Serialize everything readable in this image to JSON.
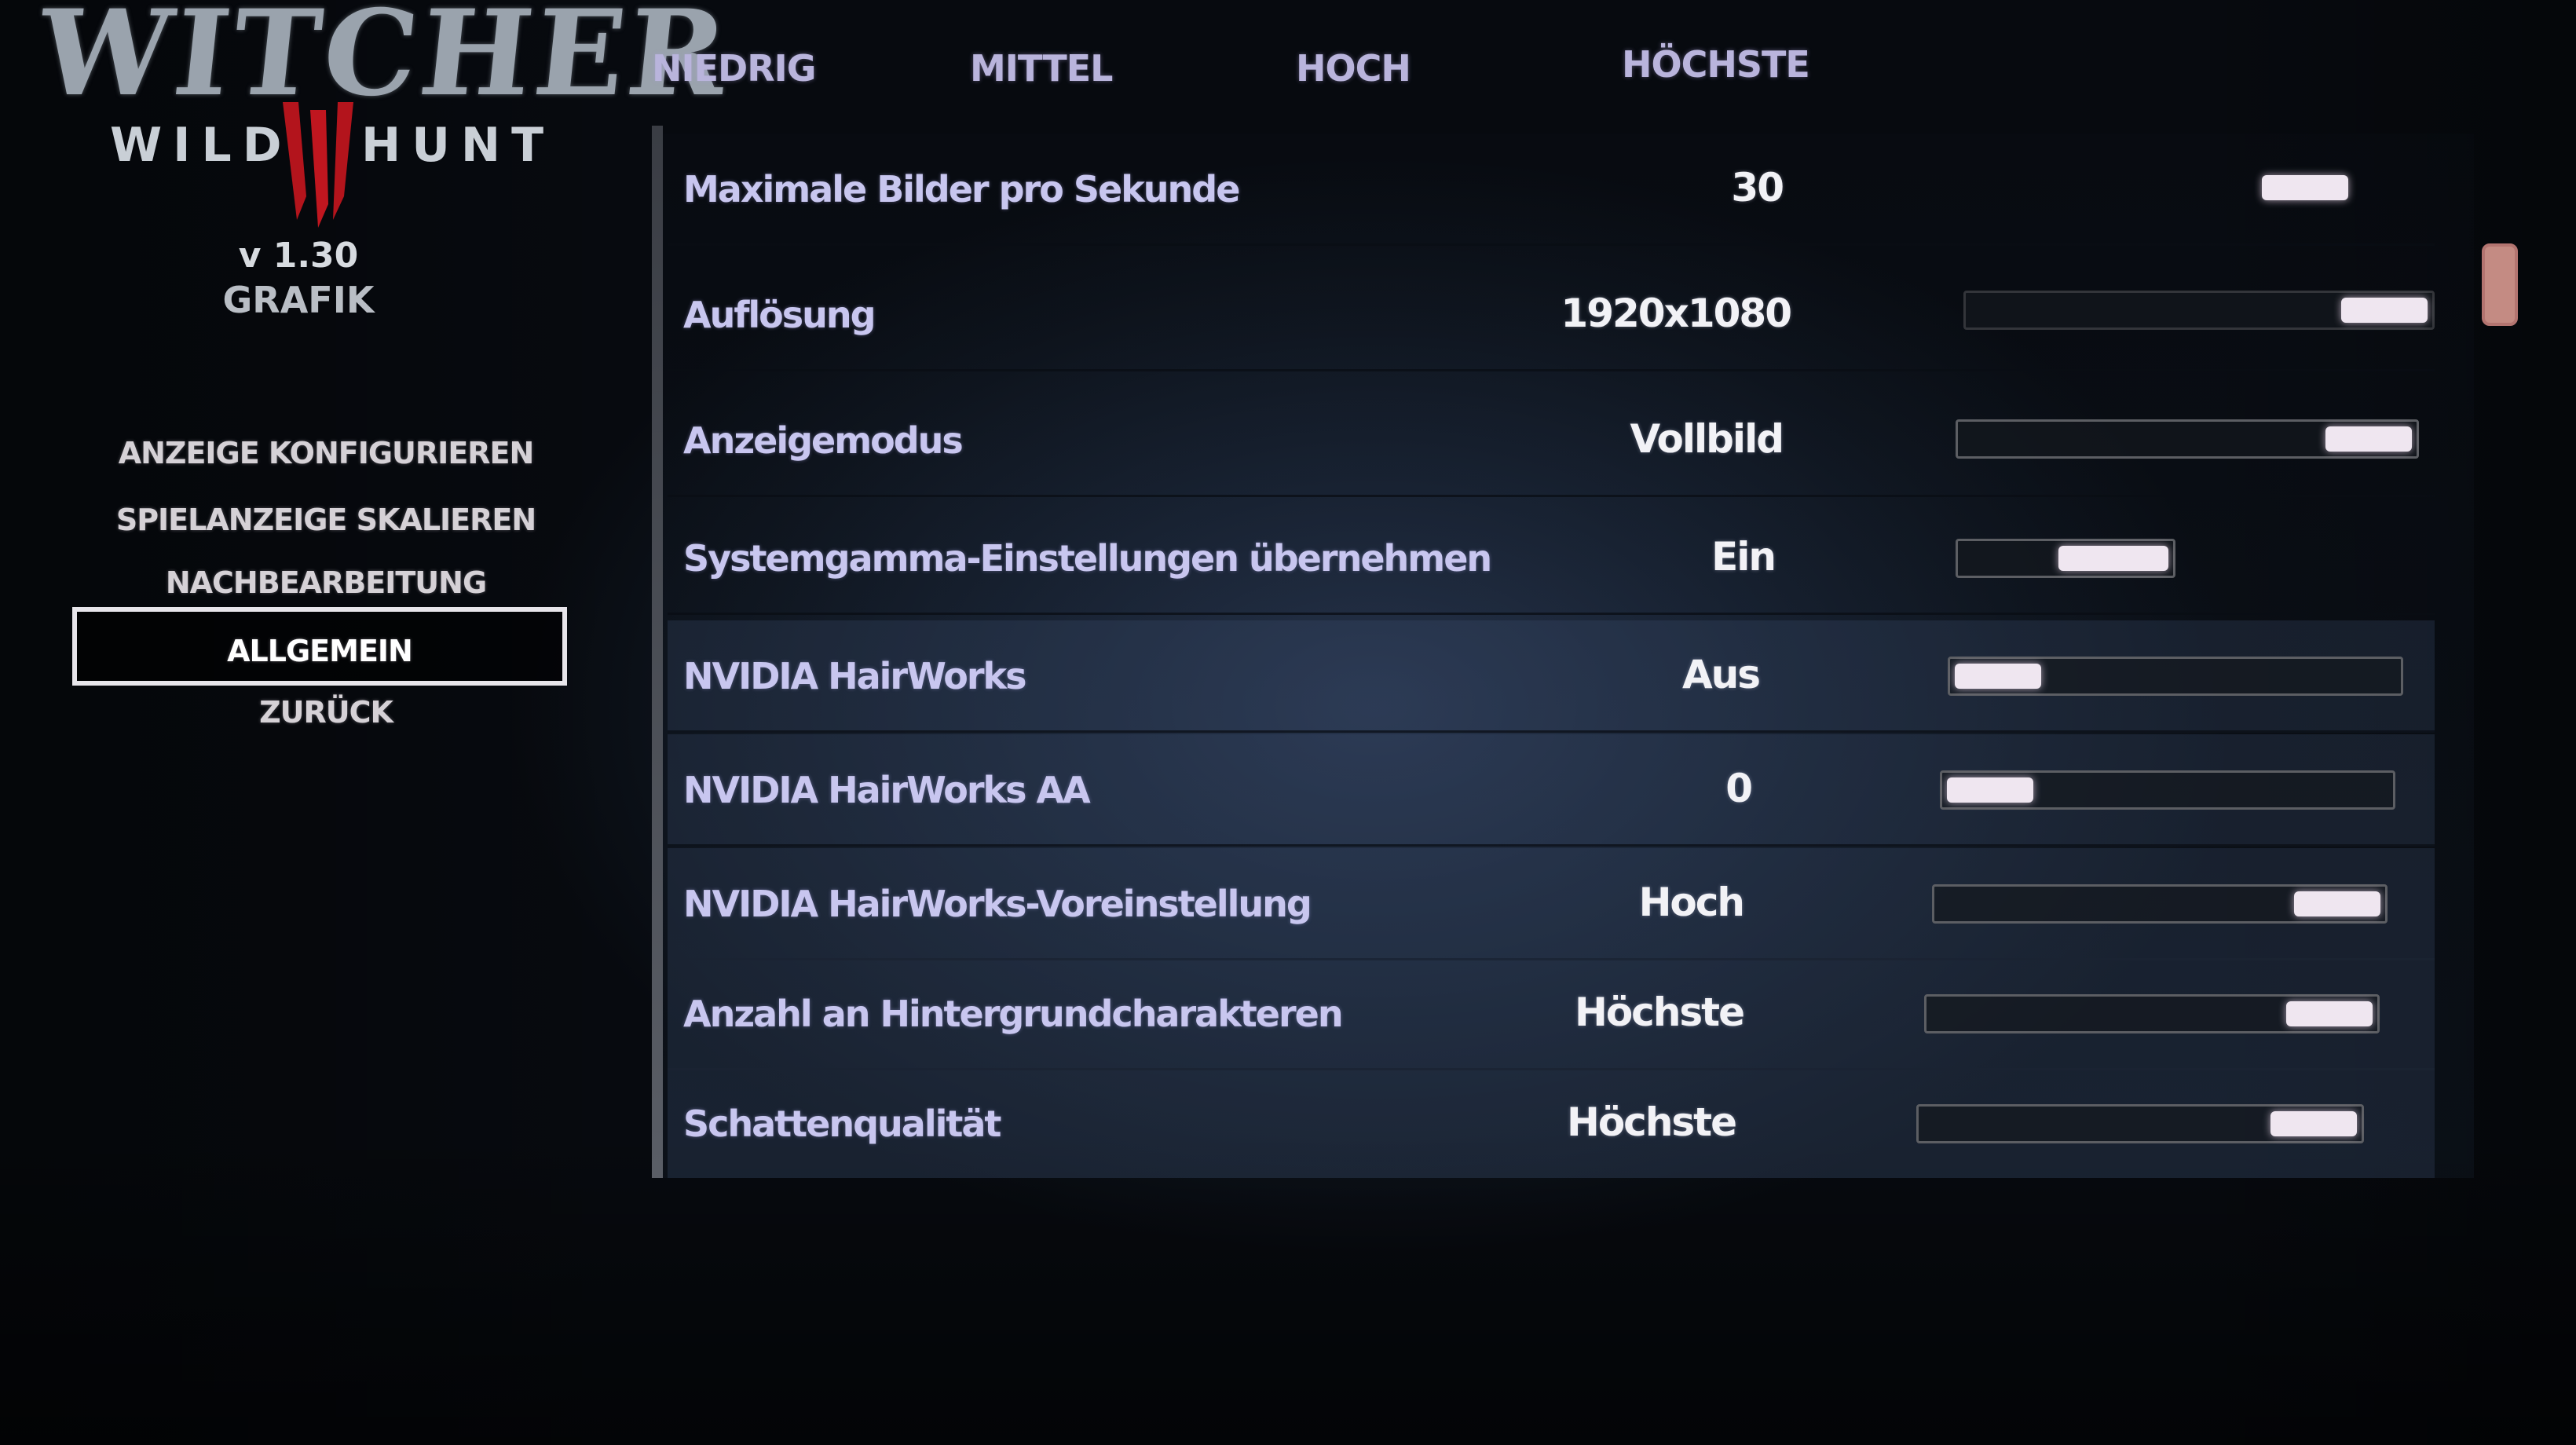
{
  "logo": {
    "title": "WITCHER",
    "sub_left": "WILD",
    "sub_right": "HUNT"
  },
  "version": "v 1.30",
  "section": "GRAFIK",
  "nav": {
    "items": [
      "ANZEIGE KONFIGURIEREN",
      "SPIELANZEIGE SKALIEREN",
      "NACHBEARBEITUNG",
      "ALLGEMEIN",
      "ZURÜCK"
    ],
    "selected": "ALLGEMEIN"
  },
  "presets": [
    "NIEDRIG",
    "MITTEL",
    "HOCH",
    "HÖCHSTE"
  ],
  "settings": [
    {
      "label": "Maximale Bilder pro Sekunde",
      "value": "30",
      "level": 0.9
    },
    {
      "label": "Auflösung",
      "value": "1920x1080",
      "level": 1.0
    },
    {
      "label": "Anzeigemodus",
      "value": "Vollbild",
      "level": 1.0
    },
    {
      "label": "Systemgamma-Einstellungen übernehmen",
      "value": "Ein",
      "level": 1.0
    },
    {
      "label": "NVIDIA HairWorks",
      "value": "Aus",
      "level": 0.0
    },
    {
      "label": "NVIDIA HairWorks AA",
      "value": "0",
      "level": 0.0
    },
    {
      "label": "NVIDIA HairWorks-Voreinstellung",
      "value": "Hoch",
      "level": 1.0
    },
    {
      "label": "Anzahl an Hintergrundcharakteren",
      "value": "Höchste",
      "level": 1.0
    },
    {
      "label": "Schattenqualität",
      "value": "Höchste",
      "level": 1.0
    }
  ],
  "colors": {
    "accent": "#b9b4dc",
    "thumb": "#efe6f0",
    "logo_red": "#b3141c"
  }
}
